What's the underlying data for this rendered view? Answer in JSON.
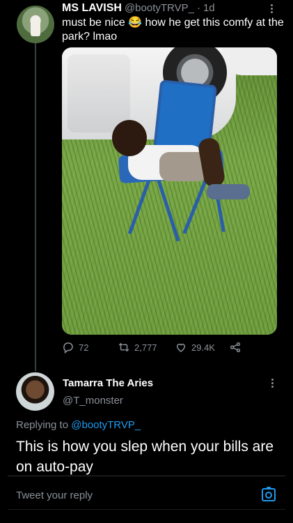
{
  "tweet1": {
    "display_name": "MS LAVISH",
    "handle": "@bootyTRVP_",
    "separator": "·",
    "time": "1d",
    "text": "must be nice 😂 how he get this comfy at the park? lmao",
    "stats": {
      "replies": "72",
      "retweets": "2,777",
      "likes": "29.4K"
    }
  },
  "tweet2": {
    "display_name": "Tamarra The Aries",
    "handle": "@T_monster",
    "replying_prefix": "Replying to",
    "replying_to": "@bootyTRVP_",
    "text": "This is how you slep when your bills are on auto-pay"
  },
  "reply_bar": {
    "placeholder": "Tweet your reply"
  },
  "icons": {
    "reply": "reply-icon",
    "retweet": "retweet-icon",
    "like": "heart-icon",
    "share": "share-icon",
    "more": "more-vertical-icon",
    "camera": "camera-icon"
  },
  "colors": {
    "background": "#000000",
    "secondary_text": "#8b9097",
    "link": "#1d9bf0"
  }
}
